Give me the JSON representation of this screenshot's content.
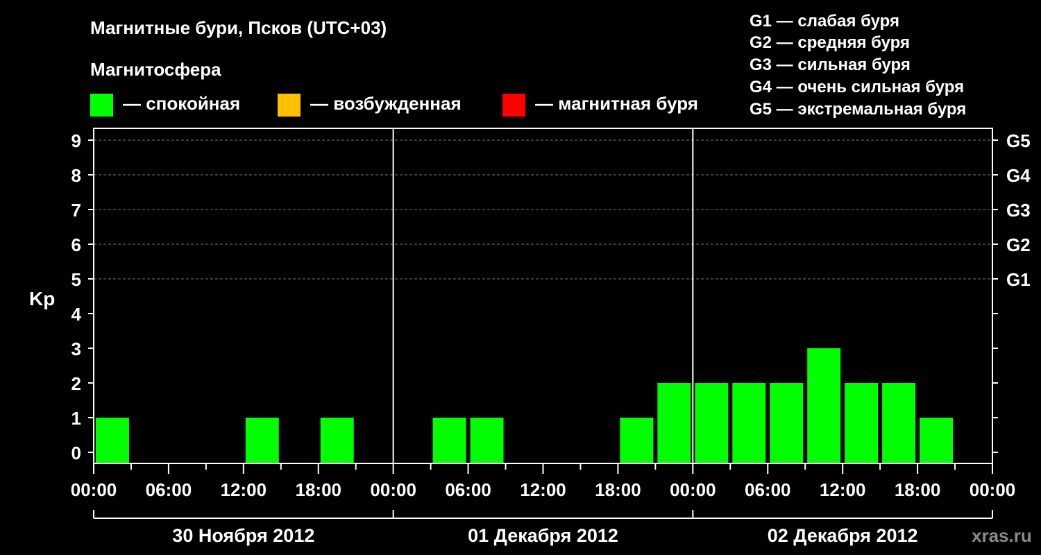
{
  "chart_data": {
    "type": "bar",
    "title": "Магнитные бури, Псков (UTC+03)",
    "legend": {
      "title": "Магнитосфера",
      "placement": "top-left",
      "items": [
        {
          "label": "— спокойная",
          "color": "#00ff00"
        },
        {
          "label": "— возбужденная",
          "color": "#ffc000"
        },
        {
          "label": "— магнитная буря",
          "color": "#ff0000"
        }
      ]
    },
    "g_legend": [
      "G1 — слабая буря",
      "G2 — средняя буря",
      "G3 — сильная буря",
      "G4 — очень сильная буря",
      "G5 — экстремальная буря"
    ],
    "ylabel": "Kp",
    "ylim": [
      0,
      9
    ],
    "yticks": [
      "0",
      "1",
      "2",
      "3",
      "4",
      "5",
      "6",
      "7",
      "8",
      "9"
    ],
    "right_axis": [
      {
        "kp": 5,
        "label": "G1"
      },
      {
        "kp": 6,
        "label": "G2"
      },
      {
        "kp": 7,
        "label": "G3"
      },
      {
        "kp": 8,
        "label": "G4"
      },
      {
        "kp": 9,
        "label": "G5"
      }
    ],
    "grid": true,
    "xtick_labels": [
      "00:00",
      "06:00",
      "12:00",
      "18:00",
      "00:00",
      "06:00",
      "12:00",
      "18:00",
      "00:00",
      "06:00",
      "12:00",
      "18:00",
      "00:00"
    ],
    "days": [
      "30 Ноября 2012",
      "01 Декабря 2012",
      "02 Декабря 2012"
    ],
    "bar_color": "#00ff00",
    "values": [
      1,
      0,
      0,
      0,
      1,
      0,
      1,
      0,
      0,
      1,
      1,
      0,
      0,
      0,
      1,
      2,
      2,
      2,
      2,
      3,
      2,
      2,
      1,
      0
    ]
  },
  "watermark": "xras.ru"
}
